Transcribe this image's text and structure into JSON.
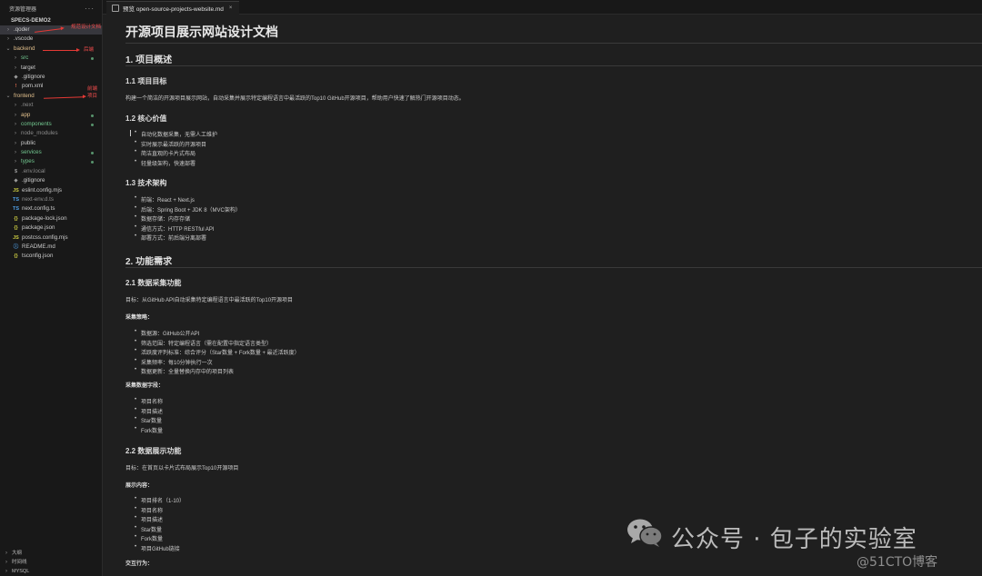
{
  "sidebar": {
    "header": "资源管理器",
    "dots": "···",
    "project": "SPECS-DEMO2",
    "tree": [
      {
        "label": ".qoder",
        "chev": "›",
        "icon": "",
        "color": "default",
        "indent": 0,
        "selected": true
      },
      {
        "label": ".vscode",
        "chev": "›",
        "icon": "",
        "color": "default",
        "indent": 0
      },
      {
        "label": "backend",
        "chev": "⌄",
        "icon": "",
        "color": "yellow",
        "indent": 0
      },
      {
        "label": "src",
        "chev": "›",
        "icon": "",
        "color": "green",
        "indent": 1,
        "dot": true
      },
      {
        "label": "target",
        "chev": "›",
        "icon": "",
        "color": "default",
        "indent": 1
      },
      {
        "label": ".gitignore",
        "chev": "",
        "icon": "◆",
        "color": "default",
        "indent": 1
      },
      {
        "label": "pom.xml",
        "chev": "",
        "icon": "!",
        "color": "default",
        "indent": 1
      },
      {
        "label": "frontend",
        "chev": "⌄",
        "icon": "",
        "color": "yellow",
        "indent": 0
      },
      {
        "label": ".next",
        "chev": "›",
        "icon": "",
        "color": "dim",
        "indent": 1
      },
      {
        "label": "app",
        "chev": "›",
        "icon": "",
        "color": "yellow",
        "indent": 1,
        "dot": true
      },
      {
        "label": "components",
        "chev": "›",
        "icon": "",
        "color": "green",
        "indent": 1,
        "dot": true
      },
      {
        "label": "node_modules",
        "chev": "›",
        "icon": "",
        "color": "dim",
        "indent": 1
      },
      {
        "label": "public",
        "chev": "›",
        "icon": "",
        "color": "default",
        "indent": 1
      },
      {
        "label": "services",
        "chev": "›",
        "icon": "",
        "color": "green",
        "indent": 1,
        "dot": true
      },
      {
        "label": "types",
        "chev": "›",
        "icon": "",
        "color": "green",
        "indent": 1,
        "dot": true
      },
      {
        "label": ".env.local",
        "chev": "",
        "icon": "$",
        "color": "dim",
        "indent": 1
      },
      {
        "label": ".gitignore",
        "chev": "",
        "icon": "◆",
        "color": "default",
        "indent": 1
      },
      {
        "label": "eslint.config.mjs",
        "chev": "",
        "icon": "JS",
        "color": "default",
        "indent": 1
      },
      {
        "label": "next-env.d.ts",
        "chev": "",
        "icon": "TS",
        "color": "dim",
        "indent": 1
      },
      {
        "label": "next.config.ts",
        "chev": "",
        "icon": "TS",
        "color": "default",
        "indent": 1
      },
      {
        "label": "package-lock.json",
        "chev": "",
        "icon": "{}",
        "color": "default",
        "indent": 1
      },
      {
        "label": "package.json",
        "chev": "",
        "icon": "{}",
        "color": "default",
        "indent": 1
      },
      {
        "label": "postcss.config.mjs",
        "chev": "",
        "icon": "JS",
        "color": "default",
        "indent": 1
      },
      {
        "label": "README.md",
        "chev": "",
        "icon": "ⓘ",
        "color": "default",
        "indent": 1
      },
      {
        "label": "tsconfig.json",
        "chev": "",
        "icon": "{}",
        "color": "default",
        "indent": 1
      }
    ],
    "notes": {
      "qoder": "规范设计文档",
      "backend": "后端",
      "frontend": "前端项目"
    },
    "bottom": [
      {
        "label": "大纲",
        "chev": "›"
      },
      {
        "label": "时间线",
        "chev": "›"
      },
      {
        "label": "MYSQL",
        "chev": "›"
      }
    ],
    "colors": {
      "green": "#73c991",
      "yellow": "#e2c08d",
      "dim": "#8b8b8b",
      "default": "#cccccc"
    }
  },
  "tab": {
    "label": "预览 open-source-projects-website.md",
    "close": "×"
  },
  "doc": {
    "title": "开源项目展示网站设计文档",
    "s1": {
      "heading": "1. 项目概述",
      "s11": {
        "heading": "1.1 项目目标",
        "text": "构建一个简洁的开源项目展示网站，自动采集并展示特定编程语言中最活跃的Top10 GitHub开源项目，帮助用户快速了解热门开源项目动态。"
      },
      "s12": {
        "heading": "1.2 核心价值",
        "items": [
          "自动化数据采集，无需人工维护",
          "实时展示最活跃的开源项目",
          "简洁直观的卡片式布局",
          "轻量级架构，快速部署"
        ]
      },
      "s13": {
        "heading": "1.3 技术架构",
        "items": [
          "前端：React + Next.js",
          "后端：Spring Boot + JDK 8（MVC架构）",
          "数据存储：内存存储",
          "通信方式：HTTP RESTful API",
          "部署方式：前后端分离部署"
        ]
      }
    },
    "s2": {
      "heading": "2. 功能需求",
      "s21": {
        "heading": "2.1 数据采集功能",
        "goal": "目标：从GitHub API自动采集特定编程语言中最活跃的Top10开源项目",
        "strategy_label": "采集策略：",
        "strategy": [
          "数据源：GitHub公开API",
          "筛选范围：特定编程语言（需在配置中指定语言类型）",
          "活跃度评判标准：综合评分（Star数量 + Fork数量 + 最近活跃度）",
          "采集频率：每10分钟执行一次",
          "数据更新：全量替换内存中的项目列表"
        ],
        "fields_label": "采集数据字段：",
        "fields": [
          "项目名称",
          "项目描述",
          "Star数量",
          "Fork数量"
        ]
      },
      "s22": {
        "heading": "2.2 数据展示功能",
        "goal": "目标：在首页以卡片式布局展示Top10开源项目",
        "content_label": "展示内容：",
        "content": [
          "项目排名（1-10）",
          "项目名称",
          "项目描述",
          "Star数量",
          "Fork数量",
          "项目GitHub链接"
        ],
        "interaction_label": "交互行为："
      }
    }
  },
  "watermark": {
    "text": "公众号 · 包子的实验室",
    "sub": "@51CTO博客",
    "icon": "wechat-icon"
  }
}
